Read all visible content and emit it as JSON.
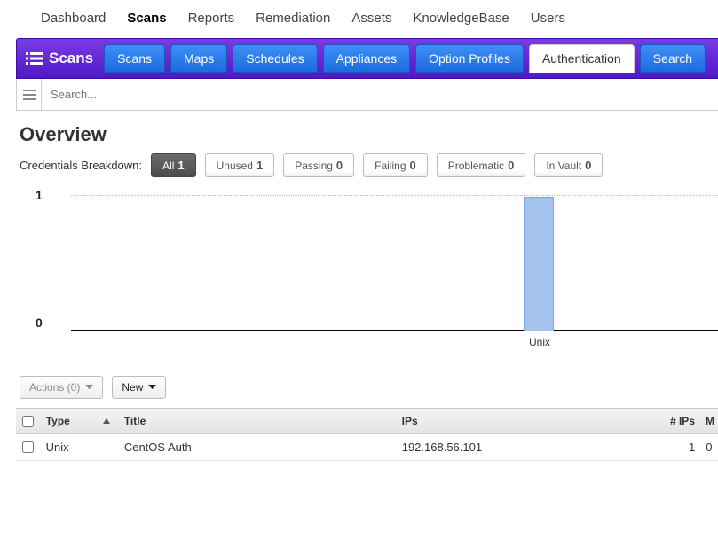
{
  "topnav": [
    "Dashboard",
    "Scans",
    "Reports",
    "Remediation",
    "Assets",
    "KnowledgeBase",
    "Users"
  ],
  "topnav_active": "Scans",
  "brand": "Scans",
  "subtabs": [
    "Scans",
    "Maps",
    "Schedules",
    "Appliances",
    "Option Profiles",
    "Authentication",
    "Search"
  ],
  "subtabs_active": "Authentication",
  "search": {
    "placeholder": "Search...",
    "value": ""
  },
  "overview": {
    "title": "Overview",
    "breakdown_label": "Credentials Breakdown:",
    "filters": [
      {
        "label": "All",
        "count": 1,
        "active": true
      },
      {
        "label": "Unused",
        "count": 1,
        "active": false
      },
      {
        "label": "Passing",
        "count": 0,
        "active": false
      },
      {
        "label": "Failing",
        "count": 0,
        "active": false
      },
      {
        "label": "Problematic",
        "count": 0,
        "active": false
      },
      {
        "label": "In Vault",
        "count": 0,
        "active": false
      }
    ]
  },
  "chart_data": {
    "type": "bar",
    "categories": [
      "Unix"
    ],
    "values": [
      1
    ],
    "title": "",
    "xlabel": "",
    "ylabel": "",
    "ylim": [
      0,
      1
    ],
    "yticks": [
      0,
      1
    ]
  },
  "actions": {
    "actions_label": "Actions (0)",
    "new_label": "New"
  },
  "table": {
    "columns": {
      "type": "Type",
      "title": "Title",
      "ips": "IPs",
      "nips": "# IPs",
      "m": "M"
    },
    "sort_column": "type",
    "rows": [
      {
        "type": "Unix",
        "title": "CentOS Auth",
        "ips": "192.168.56.101",
        "nips": "1",
        "m": "0"
      }
    ]
  }
}
